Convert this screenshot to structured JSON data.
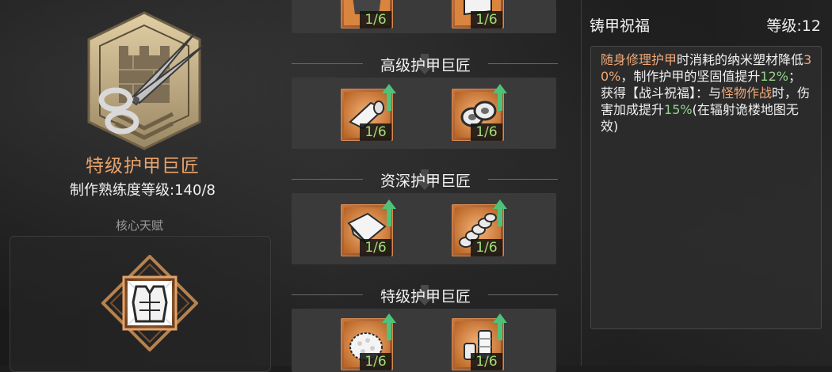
{
  "left": {
    "rank_title": "特级护甲巨匠",
    "proficiency_label": "制作熟练度等级:140/8",
    "core_talent_label": "核心天赋",
    "badge_icon": "scissors-fortress-icon",
    "core_icon": "armor-vest-icon"
  },
  "tree": {
    "top_row": {
      "items": [
        {
          "icon": "armor-plate-icon",
          "count": "1/6"
        },
        {
          "icon": "armor-plate-icon",
          "count": "1/6"
        }
      ]
    },
    "tiers": [
      {
        "title": "高级护甲巨匠",
        "items": [
          {
            "icon": "fabric-roll-icon",
            "count": "1/6",
            "upgradable": true
          },
          {
            "icon": "tape-rolls-icon",
            "count": "1/6",
            "upgradable": true
          }
        ]
      },
      {
        "title": "资深护甲巨匠",
        "items": [
          {
            "icon": "folded-cloth-icon",
            "count": "1/6",
            "upgradable": true
          },
          {
            "icon": "twisted-fiber-icon",
            "count": "1/6",
            "upgradable": true
          }
        ]
      },
      {
        "title": "特级护甲巨匠",
        "items": [
          {
            "icon": "cotton-ball-icon",
            "count": "1/6",
            "upgradable": true
          },
          {
            "icon": "spools-icon",
            "count": "1/6",
            "upgradable": true
          }
        ]
      }
    ]
  },
  "detail": {
    "name": "铸甲祝福",
    "level": "等级:12",
    "description": [
      {
        "text": "随身修理护甲",
        "color": "orange"
      },
      {
        "text": "时消耗的纳米塑材降低",
        "color": "white"
      },
      {
        "text": "30%",
        "color": "orange"
      },
      {
        "text": "，制作护甲的坚固值提升",
        "color": "white"
      },
      {
        "text": "12%",
        "color": "green"
      },
      {
        "text": "；",
        "color": "white"
      },
      {
        "text": "\n获得【战斗祝福】：与",
        "color": "white"
      },
      {
        "text": "怪物作战",
        "color": "orange"
      },
      {
        "text": "时，伤害加成提升",
        "color": "white"
      },
      {
        "text": "15%",
        "color": "green"
      },
      {
        "text": "(在辐射诡楼地图无效)",
        "color": "white"
      }
    ]
  },
  "colors": {
    "accent_orange": "#e9a36b",
    "count_green": "#9fe07a",
    "panel_bg": "#3a3a3a"
  }
}
